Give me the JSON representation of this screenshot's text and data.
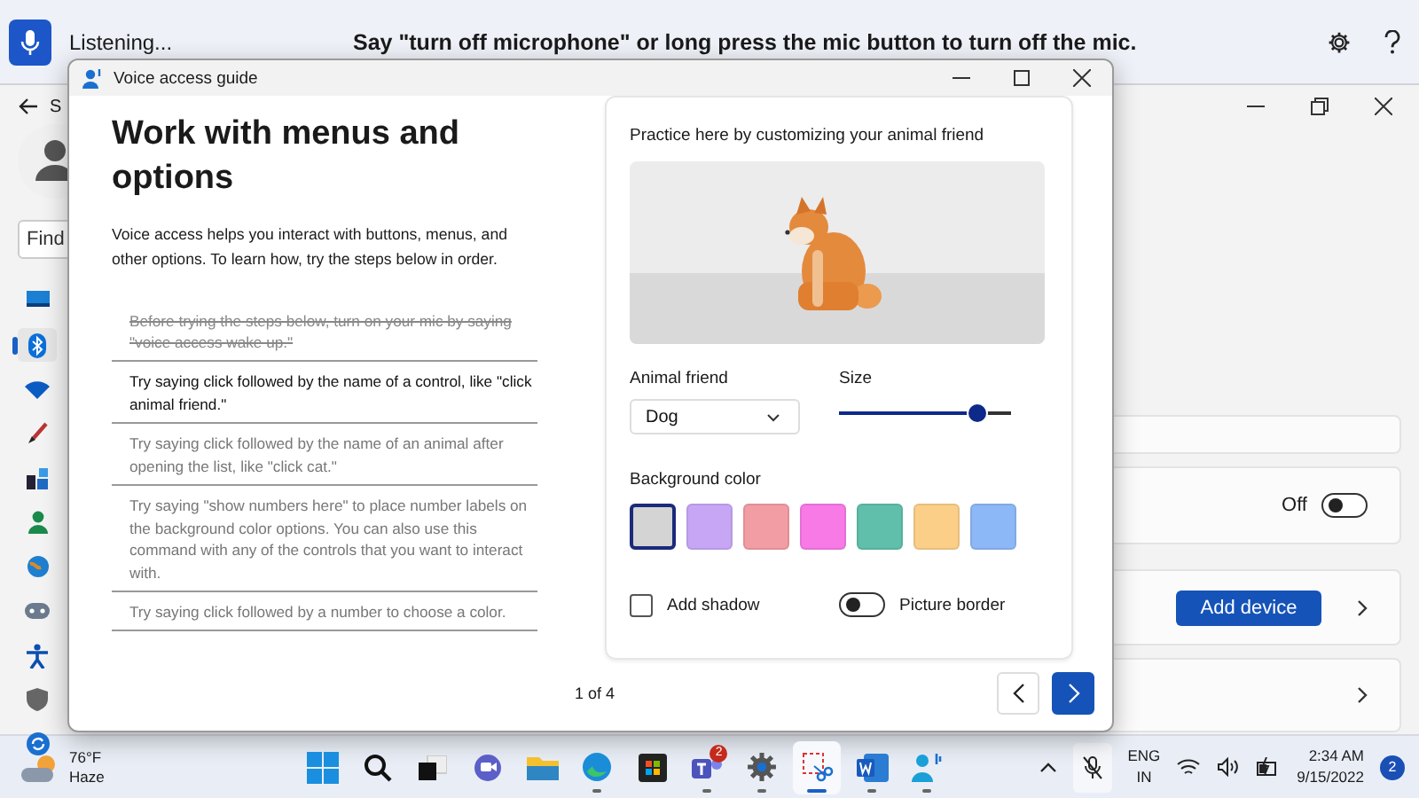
{
  "voice_bar": {
    "status": "Listening...",
    "message": "Say \"turn off microphone\" or long press the mic button to turn off the mic.",
    "mic_on": true
  },
  "settings_window": {
    "title": "S",
    "search": {
      "placeholder": "Find"
    },
    "nav_icons": [
      {
        "kind": "display",
        "selected": false
      },
      {
        "kind": "bluetooth",
        "selected": true
      },
      {
        "kind": "wifi",
        "selected": false
      },
      {
        "kind": "brush",
        "selected": false
      },
      {
        "kind": "apps",
        "selected": false
      },
      {
        "kind": "person",
        "selected": false
      },
      {
        "kind": "globe",
        "selected": false
      },
      {
        "kind": "gamepad",
        "selected": false
      },
      {
        "kind": "accessibility",
        "selected": false
      },
      {
        "kind": "shield",
        "selected": false
      },
      {
        "kind": "update",
        "selected": false
      }
    ],
    "cards": [
      {
        "kind": "plain"
      },
      {
        "kind": "toggle",
        "label": "Off",
        "on": false
      },
      {
        "kind": "button",
        "button": "Add device"
      },
      {
        "kind": "link"
      }
    ]
  },
  "dialog": {
    "title": "Voice access guide",
    "heading": "Work with menus and options",
    "intro": "Voice access helps you interact with buttons, menus, and other options. To learn how, try the steps below in order.",
    "steps": [
      {
        "text": "Before trying the steps below, turn on your mic by saying \"voice access wake up.\"",
        "done": true,
        "current": false
      },
      {
        "text": "Try saying click followed by the name of a control, like \"click animal friend.\"",
        "done": false,
        "current": true
      },
      {
        "text": "Try saying click followed by the name of an animal after opening the list, like \"click cat.\"",
        "done": false,
        "current": false
      },
      {
        "text": "Try saying \"show numbers here\" to place number labels on the background color options. You can also use this command with any of the controls that you want to interact with.",
        "done": false,
        "current": false
      },
      {
        "text": "Try saying click followed by a number to choose a color.",
        "done": false,
        "current": false
      }
    ],
    "practice": {
      "heading": "Practice here by customizing your animal friend",
      "animal_label": "Animal friend",
      "animal": "Dog",
      "size_label": "Size",
      "size": {
        "level": 0.8
      },
      "color_label": "Background color",
      "colors": [
        {
          "color": "#d4d4d4",
          "selected": true
        },
        {
          "color": "#c7a6f5",
          "selected": false
        },
        {
          "color": "#f29ca3",
          "selected": false
        },
        {
          "color": "#f77ae6",
          "selected": false
        },
        {
          "color": "#5fbfaa",
          "selected": false
        },
        {
          "color": "#fbcf88",
          "selected": false
        },
        {
          "color": "#8cb8f7",
          "selected": false
        }
      ],
      "shadow": {
        "label": "Add shadow",
        "checked": false
      },
      "border": {
        "label": "Picture border",
        "on": false
      }
    },
    "page": "1 of 4"
  },
  "taskbar": {
    "weather": {
      "temp": "76°F",
      "condition": "Haze"
    },
    "apps": [
      {
        "kind": "start",
        "running": false,
        "active": false
      },
      {
        "kind": "search",
        "running": false,
        "active": false
      },
      {
        "kind": "taskview",
        "running": false,
        "active": false
      },
      {
        "kind": "chat",
        "running": false,
        "active": false
      },
      {
        "kind": "folder",
        "running": false,
        "active": false
      },
      {
        "kind": "browser",
        "running": true,
        "active": false
      },
      {
        "kind": "store",
        "running": false,
        "active": false
      },
      {
        "kind": "teams",
        "running": true,
        "active": false,
        "badge": "2"
      },
      {
        "kind": "gear",
        "running": true,
        "active": false
      },
      {
        "kind": "snip",
        "running": true,
        "active": true
      },
      {
        "kind": "word",
        "running": true,
        "active": false
      },
      {
        "kind": "voice",
        "running": true,
        "active": false
      }
    ],
    "language": "ENG",
    "region": "IN",
    "time": "2:34 AM",
    "date": "9/15/2022",
    "notifications": "2"
  }
}
